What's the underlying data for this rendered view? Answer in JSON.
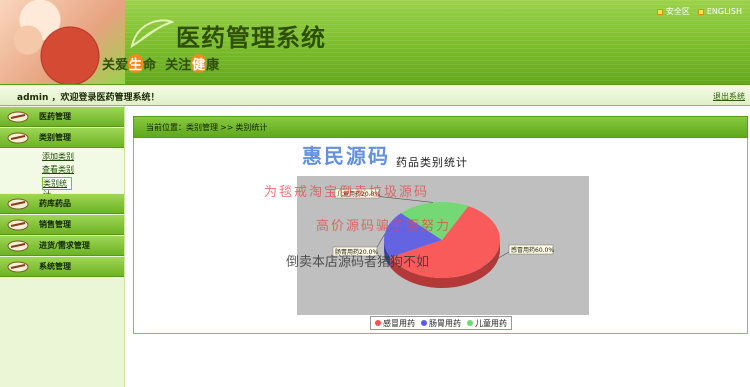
{
  "header": {
    "system_title": "医药管理系统",
    "slogan": {
      "p1": "关爱",
      "hl1": "生",
      "p2": "命  关注",
      "hl2": "健",
      "p3": "康"
    },
    "top_links": [
      {
        "label": "安全区",
        "icon": "yellow-square-icon"
      },
      {
        "label": "ENGLISH",
        "icon": "yellow-square-icon"
      }
    ]
  },
  "userbar": {
    "greeting": "admin ，欢迎登录医药管理系统！",
    "logout": "退出系统"
  },
  "sidebar": {
    "items": [
      {
        "label": "医药管理",
        "icon": "pen-icon"
      },
      {
        "label": "类别管理",
        "icon": "pen-icon"
      },
      {
        "label": "药库药品",
        "icon": "pen-icon"
      },
      {
        "label": "销售管理",
        "icon": "pen-icon"
      },
      {
        "label": "进货/需求管理",
        "icon": "pen-icon"
      },
      {
        "label": "系统管理",
        "icon": "pen-icon"
      }
    ],
    "subitems": [
      "添加类别",
      "查看类别",
      "类别统计"
    ],
    "active_subitem": "类别统计"
  },
  "breadcrumb": {
    "prefix": "当前位置：",
    "first": "类别管理",
    "sep": ">>",
    "current": "类别统计"
  },
  "watermark": {
    "brand": "惠民源码",
    "line1": "为毯戒淘宝倒卖垃圾源码",
    "line2": "高价源码骗子而努力",
    "line3": "倒卖本店源码者猪狗不如"
  },
  "chart_data": {
    "type": "pie",
    "title": "药品类别统计",
    "labels": [
      "感冒用药",
      "肠胃用药",
      "儿童用药"
    ],
    "values": [
      60,
      20,
      20
    ],
    "slice_labels": [
      "感冒用药60.0%",
      "肠胃用药20.0%",
      "儿童用药20.0%"
    ],
    "colors": [
      "#ff5050",
      "#5a5ae6",
      "#6cdc6c"
    ],
    "legend_position": "bottom",
    "plot_background": "#bfbfbf",
    "style": "3d"
  },
  "colors": {
    "accent": "#7cbd2c",
    "dark_green": "#2e4f08",
    "menu_green": "#6cb324"
  }
}
